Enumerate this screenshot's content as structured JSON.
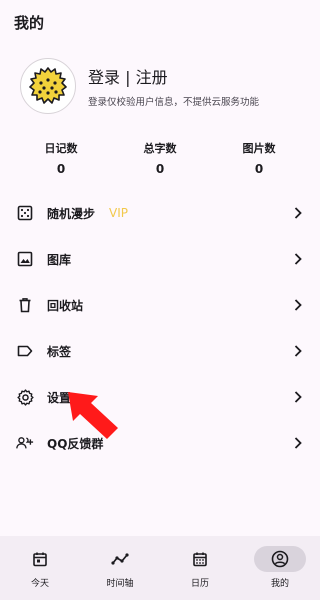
{
  "page": {
    "title": "我的"
  },
  "profile": {
    "login_title": "登录 | 注册",
    "description": "登录仅校验用户信息，不提供云服务功能",
    "avatar_icon": "durian-icon"
  },
  "stats": [
    {
      "label": "日记数",
      "value": "0"
    },
    {
      "label": "总字数",
      "value": "0"
    },
    {
      "label": "图片数",
      "value": "0"
    }
  ],
  "menu": [
    {
      "label": "随机漫步",
      "badge": "VIP",
      "icon": "dice-icon"
    },
    {
      "label": "图库",
      "icon": "image-icon"
    },
    {
      "label": "回收站",
      "icon": "trash-icon"
    },
    {
      "label": "标签",
      "icon": "tag-icon"
    },
    {
      "label": "设置",
      "icon": "gear-icon"
    },
    {
      "label": "QQ反馈群",
      "icon": "group-add-icon"
    }
  ],
  "bottom_nav": [
    {
      "label": "今天",
      "icon": "calendar-day-icon"
    },
    {
      "label": "时间轴",
      "icon": "timeline-icon"
    },
    {
      "label": "日历",
      "icon": "calendar-icon"
    },
    {
      "label": "我的",
      "icon": "account-icon",
      "active": true
    }
  ],
  "colors": {
    "vip": "#f2c94c",
    "arrow": "#ff1a1a",
    "accent_bg": "#d9d3dc"
  }
}
